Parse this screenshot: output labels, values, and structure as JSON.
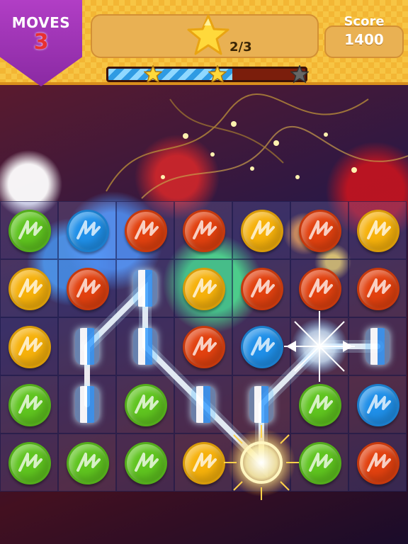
{
  "hud": {
    "moves_label": "MOVES",
    "moves_value": "3",
    "goal_count": "2/3",
    "score_label": "Score",
    "score_value": "1400",
    "progress_fraction": 0.63,
    "progress_stars": [
      "star-earned",
      "star-earned",
      "star-unearned"
    ]
  },
  "colors": {
    "green": "#5fc41f",
    "blue": "#1f8fe8",
    "red": "#e2410f",
    "yellow": "#f6b10b",
    "purple_banner": "#9b33b6",
    "hud_yellow": "#f7c544"
  },
  "board": {
    "rows": [
      [
        "green",
        "blue",
        "red",
        "red",
        "yellow",
        "red",
        "yellow"
      ],
      [
        "yellow",
        "red",
        "empty",
        "yellow",
        "red",
        "red",
        "red"
      ],
      [
        "yellow",
        "empty",
        "empty",
        "red",
        "blue",
        "empty",
        "empty"
      ],
      [
        "green",
        "empty",
        "green",
        "empty",
        "empty",
        "green",
        "blue"
      ],
      [
        "green",
        "green",
        "green",
        "yellow",
        "empty",
        "green",
        "red"
      ]
    ]
  }
}
